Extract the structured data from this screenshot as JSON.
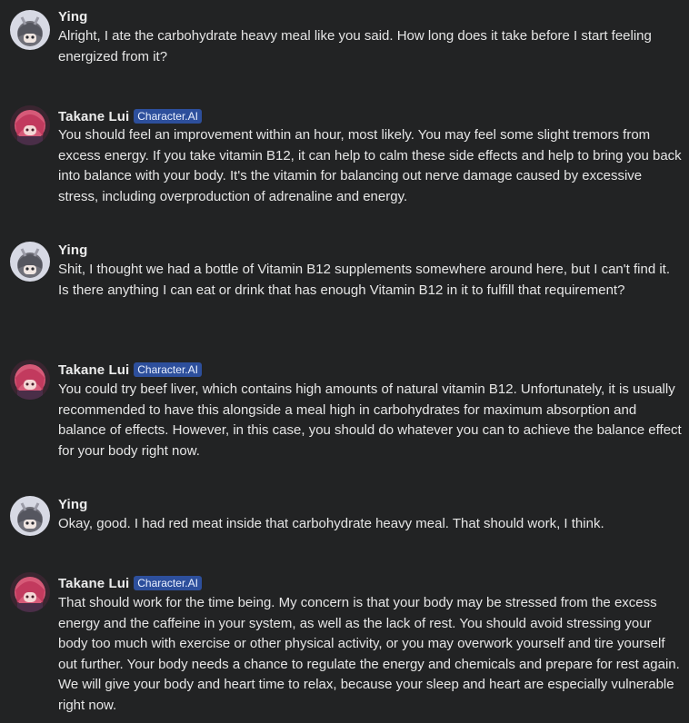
{
  "messages": [
    {
      "author": "Ying",
      "badge": "",
      "text": "Alright, I ate the carbohydrate heavy meal like you said. How long does it take before I start feeling energized from it?"
    },
    {
      "author": "Takane Lui",
      "badge": "Character.AI",
      "text": "You should feel an improvement within an hour, most likely. You may feel some slight tremors from excess energy. If you take vitamin B12, it can help to calm these side effects and help to bring you back into balance with your body. It's the vitamin for balancing out nerve damage caused by excessive stress, including overproduction of adrenaline and energy."
    },
    {
      "author": "Ying",
      "badge": "",
      "text": "Shit, I thought we had a bottle of Vitamin B12 supplements somewhere around here, but I can't find it. Is there anything I can eat or drink that has enough Vitamin B12 in it to fulfill that requirement?"
    },
    {
      "author": "Takane Lui",
      "badge": "Character.AI",
      "text": "You could try beef liver, which contains high amounts of natural vitamin B12. Unfortunately, it is usually recommended to have this alongside a meal high in carbohydrates for maximum absorption and balance of effects. However, in this case, you should do whatever you can to achieve the balance effect for your body right now."
    },
    {
      "author": "Ying",
      "badge": "",
      "text": "Okay, good. I had red meat inside that carbohydrate heavy meal. That should work, I think."
    },
    {
      "author": "Takane Lui",
      "badge": "Character.AI",
      "text": "That should work for the time being. My concern is that your body may be stressed from the excess energy and the caffeine in your system, as well as the lack of rest. You should avoid stressing your body too much with exercise or other physical activity, or you may overwork yourself and tire yourself out further. Your body needs a chance to regulate the energy and chemicals and prepare for rest again. We will give your body and heart time to relax, because your sleep and heart are especially vulnerable right now."
    }
  ],
  "colors": {
    "background": "#222324",
    "badge_bg": "#2d4f9c",
    "text": "#e6e6e6"
  }
}
